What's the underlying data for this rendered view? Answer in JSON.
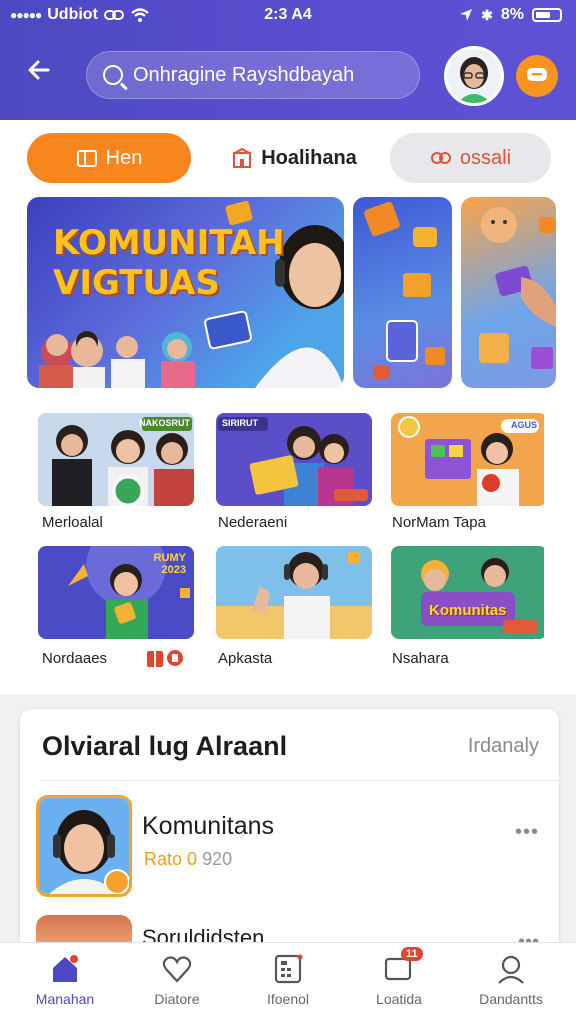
{
  "status_bar": {
    "carrier": "Udbiot",
    "time": "2:3 A4",
    "battery": "8%"
  },
  "search": {
    "placeholder": "Onhragine Rayshdbayah"
  },
  "chips": [
    {
      "label": "Hen",
      "icon": "calendar-icon"
    },
    {
      "label": "Hoalihana",
      "icon": "building-icon"
    },
    {
      "label": "ossali",
      "icon": "link-icon"
    }
  ],
  "banner": {
    "title_line1": "KOMUNITAH",
    "title_line2": "VIGTUAS"
  },
  "thumbnails": [
    {
      "label": "Merloalal",
      "badge": "NAKOSRUT"
    },
    {
      "label": "Nederaeni",
      "badge": "SIRIRUT"
    },
    {
      "label": "NorMam Tapa",
      "badge": "AGUS"
    },
    {
      "label": "Nordaaes",
      "badge": "RUMY 2023"
    },
    {
      "label": "Apkasta",
      "badge": ""
    },
    {
      "label": "Nsahara",
      "badge": "Komunitas"
    }
  ],
  "section": {
    "title": "Olviaral lug Alraanl",
    "action": "Irdanaly",
    "items": [
      {
        "name": "Komunitans",
        "rating": "Rato 0",
        "count": "920"
      },
      {
        "name": "Soruldidsten.",
        "rating": "",
        "count": ""
      }
    ]
  },
  "tabs": [
    {
      "label": "Manahan",
      "icon": "home-icon"
    },
    {
      "label": "Diatore",
      "icon": "heart-icon"
    },
    {
      "label": "Ifoenol",
      "icon": "calculator-icon"
    },
    {
      "label": "Loatida",
      "icon": "message-icon",
      "badge": "11"
    },
    {
      "label": "Dandantts",
      "icon": "profile-icon"
    }
  ],
  "colors": {
    "primary": "#4d49c2",
    "accent": "#f7861e"
  }
}
